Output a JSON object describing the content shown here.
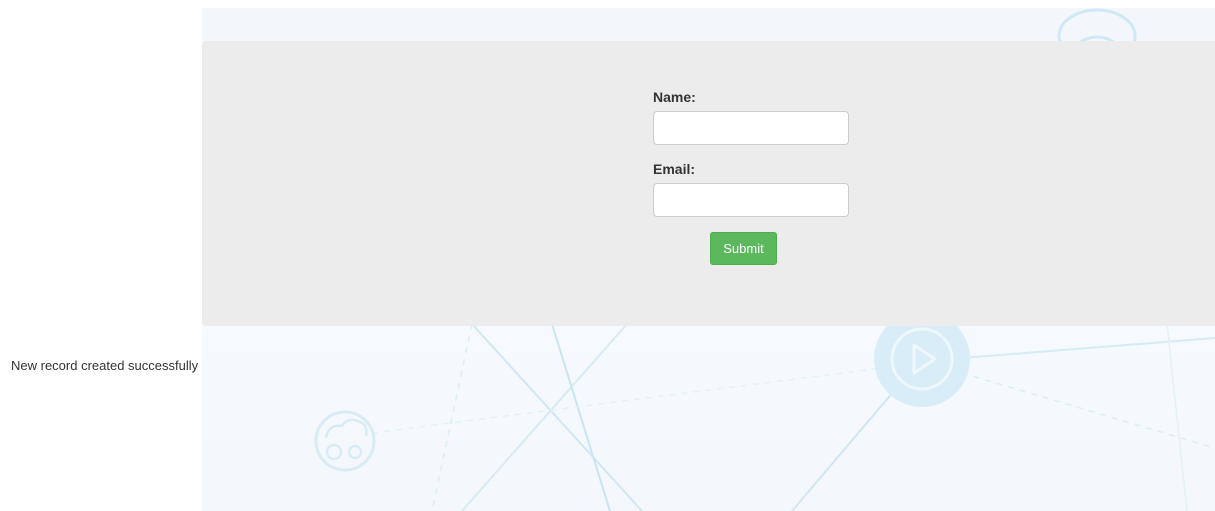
{
  "form": {
    "name_label": "Name:",
    "name_value": "",
    "email_label": "Email:",
    "email_value": "",
    "submit_label": "Submit"
  },
  "status": {
    "message": "New record created successfully"
  },
  "colors": {
    "panel_bg": "#ececec",
    "submit_bg": "#5cb85c",
    "background_accent": "#d9edf8"
  },
  "icons": [
    "wifi-icon",
    "play-icon",
    "cloud-gear-icon"
  ]
}
